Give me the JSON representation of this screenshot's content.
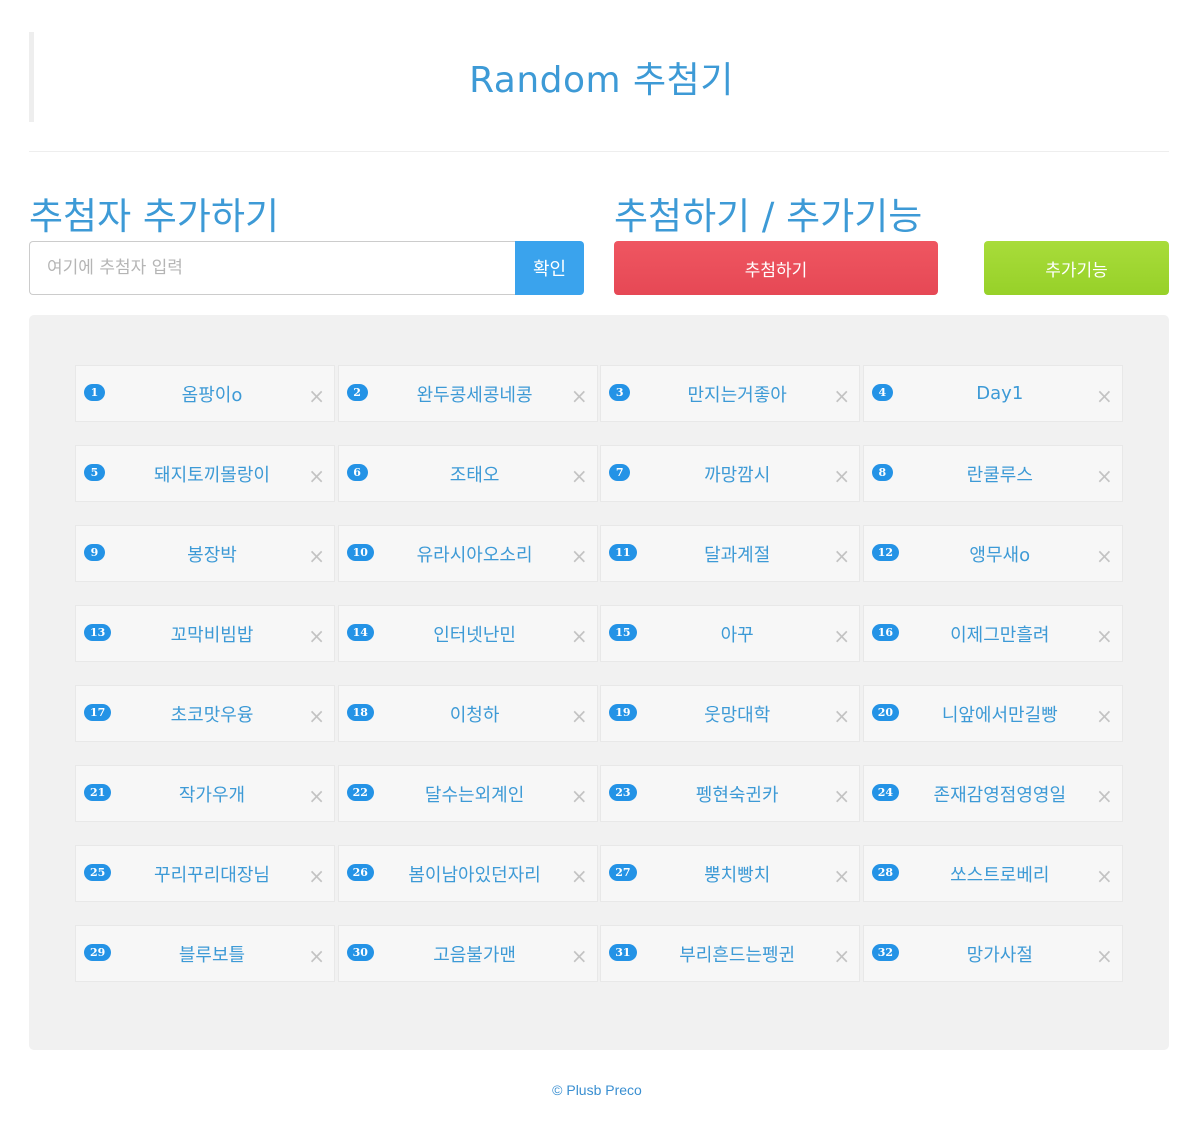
{
  "header": {
    "title": "Random 추첨기"
  },
  "add_section": {
    "title": "추첨자 추가하기",
    "input_placeholder": "여기에 추첨자 입력",
    "input_value": "",
    "confirm_label": "확인"
  },
  "draw_section": {
    "title": "추첨하기 / 추가기능",
    "draw_label": "추첨하기",
    "extra_label": "추가기능"
  },
  "close_glyph": "×",
  "participants": [
    {
      "num": "1",
      "name": "옴팡이o"
    },
    {
      "num": "2",
      "name": "완두콩세콩네콩"
    },
    {
      "num": "3",
      "name": "만지는거좋아"
    },
    {
      "num": "4",
      "name": "Day1"
    },
    {
      "num": "5",
      "name": "돼지토끼몰랑이"
    },
    {
      "num": "6",
      "name": "조태오"
    },
    {
      "num": "7",
      "name": "까망깜시"
    },
    {
      "num": "8",
      "name": "란쿨루스"
    },
    {
      "num": "9",
      "name": "봉장박"
    },
    {
      "num": "10",
      "name": "유라시아오소리"
    },
    {
      "num": "11",
      "name": "달과계절"
    },
    {
      "num": "12",
      "name": "앵무새o"
    },
    {
      "num": "13",
      "name": "꼬막비빔밥"
    },
    {
      "num": "14",
      "name": "인터넷난민"
    },
    {
      "num": "15",
      "name": "아꾸"
    },
    {
      "num": "16",
      "name": "이제그만흘려"
    },
    {
      "num": "17",
      "name": "초코맛우융"
    },
    {
      "num": "18",
      "name": "이청하"
    },
    {
      "num": "19",
      "name": "웃망대학"
    },
    {
      "num": "20",
      "name": "니앞에서만길빵"
    },
    {
      "num": "21",
      "name": "작가우개"
    },
    {
      "num": "22",
      "name": "달수는외계인"
    },
    {
      "num": "23",
      "name": "펭현숙귄카"
    },
    {
      "num": "24",
      "name": "존재감영점영영일"
    },
    {
      "num": "25",
      "name": "꾸리꾸리대장님"
    },
    {
      "num": "26",
      "name": "봄이남아있던자리"
    },
    {
      "num": "27",
      "name": "뿡치빵치"
    },
    {
      "num": "28",
      "name": "쏘스트로베리"
    },
    {
      "num": "29",
      "name": "블루보틀"
    },
    {
      "num": "30",
      "name": "고음불가맨"
    },
    {
      "num": "31",
      "name": "부리흔드는펭귄"
    },
    {
      "num": "32",
      "name": "망가사절"
    }
  ],
  "footer": {
    "text": "© Plusb Preco"
  }
}
